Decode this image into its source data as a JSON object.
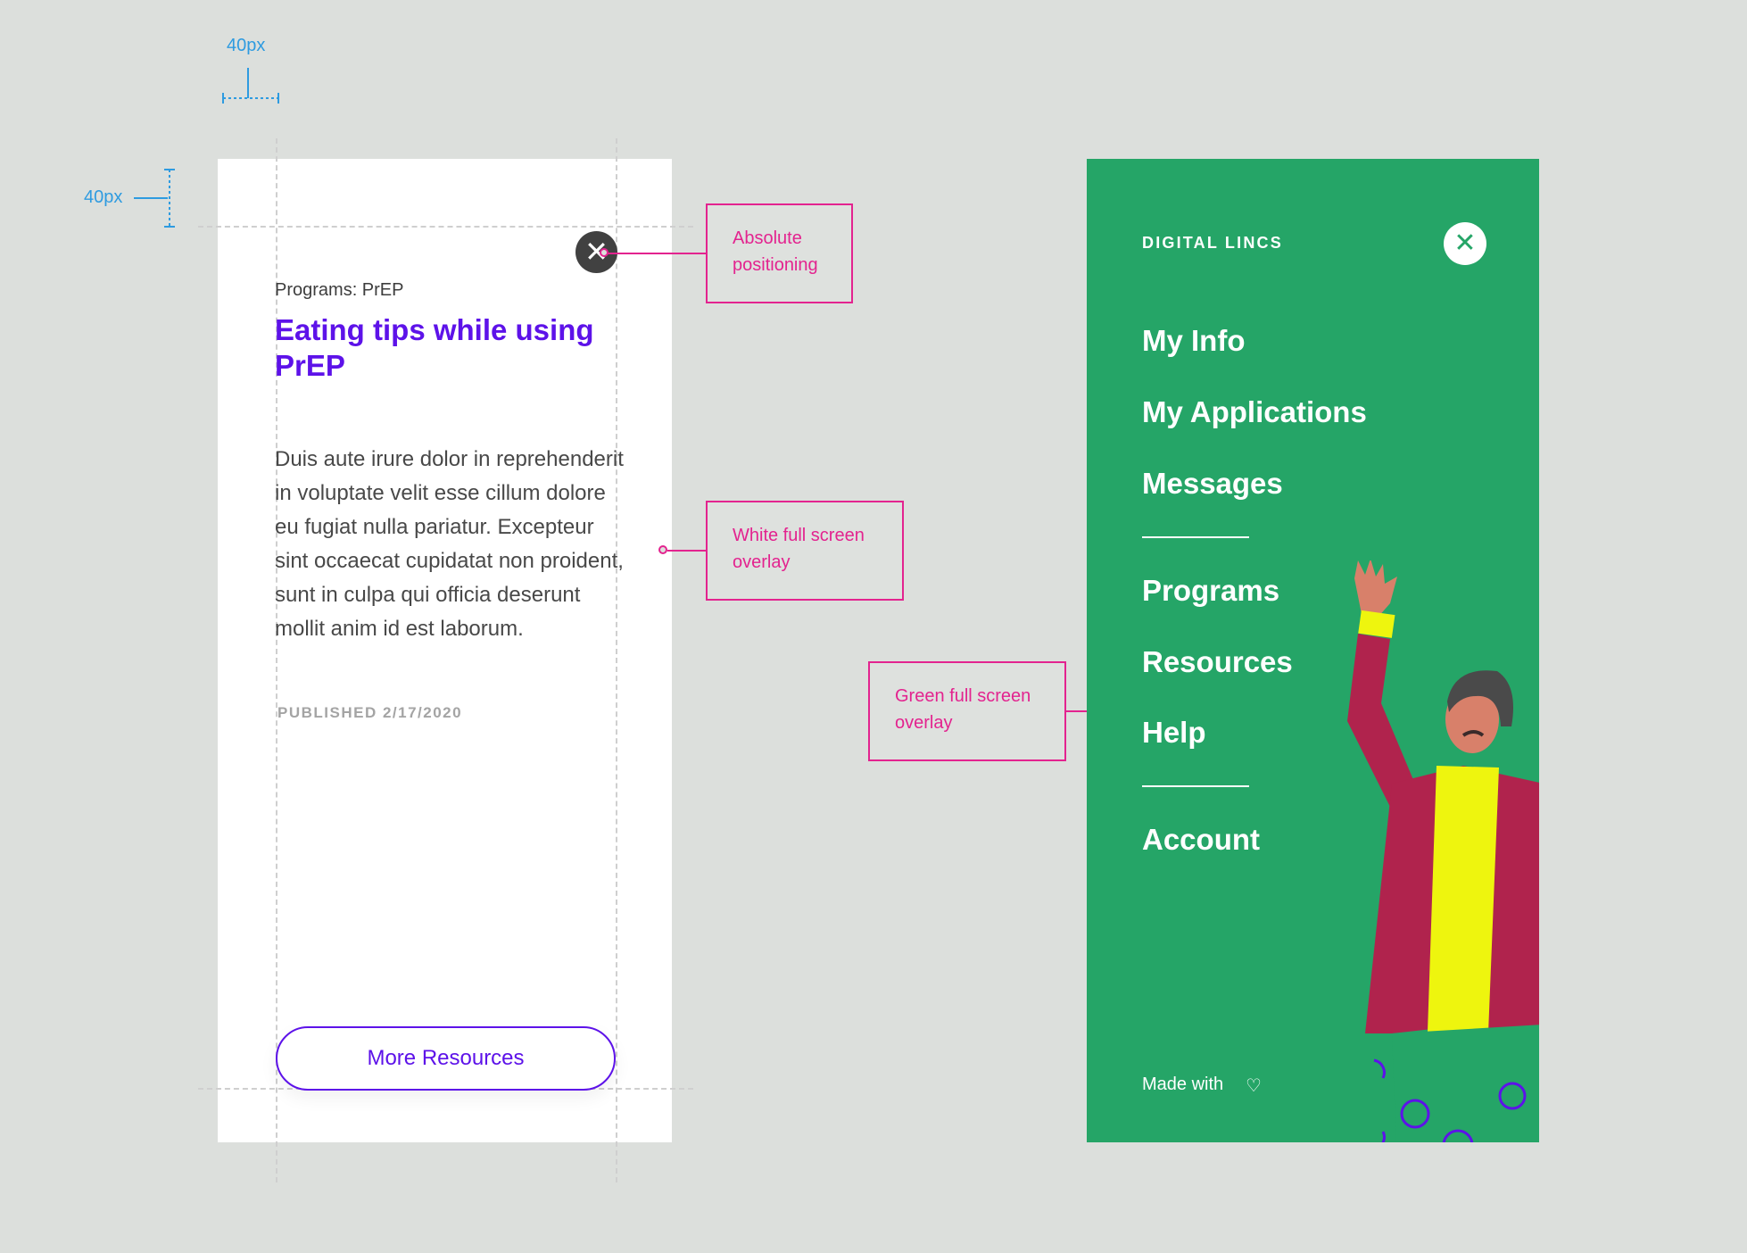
{
  "spacing_specs": {
    "horizontal": "40px",
    "vertical": "40px"
  },
  "white_overlay": {
    "breadcrumb": "Programs: PrEP",
    "title": "Eating tips while using PrEP",
    "body": "Duis aute irure dolor in reprehenderit in voluptate velit esse cillum dolore eu fugiat nulla pariatur. Excepteur sint occaecat cupidatat non proident, sunt in culpa qui officia deserunt mollit anim id est laborum.",
    "published": "PUBLISHED 2/17/2020",
    "cta_label": "More Resources",
    "close_icon": "close-icon"
  },
  "annotations": {
    "absolute_positioning": "Absolute positioning",
    "white_overlay": "White full screen overlay",
    "green_overlay": "Green full screen overlay"
  },
  "green_overlay": {
    "brand": "DIGITAL LINCS",
    "close_icon": "close-icon",
    "menu": [
      "My Info",
      "My Applications",
      "Messages",
      "Programs",
      "Resources",
      "Help",
      "Account"
    ],
    "footer_text": "Made with",
    "footer_icon": "heart-icon"
  },
  "colors": {
    "page_bg": "#dcdfdc",
    "accent_purple": "#5d12e9",
    "annotation_pink": "#e3238f",
    "measure_blue": "#2e9be0",
    "menu_green": "#25a567"
  }
}
